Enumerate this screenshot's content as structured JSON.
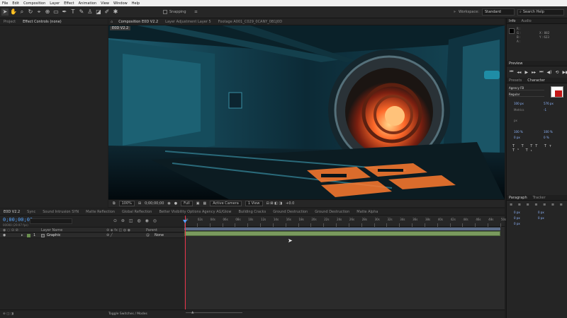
{
  "menu": [
    "File",
    "Edit",
    "Composition",
    "Layer",
    "Effect",
    "Animation",
    "View",
    "Window",
    "Help"
  ],
  "toolbar": {
    "snapping_label": "Snapping",
    "workspace_label": "Workspace:",
    "workspace_value": "Standard",
    "search_placeholder": "Search Help"
  },
  "project_tabs": [
    "Project",
    "Effect Controls (none)"
  ],
  "comp_tabs": [
    "Composition E0D V2.2",
    "Layer Adjustment Layer 5",
    "Footage A001_C029_0CANY_0B1J0D"
  ],
  "comp_crumb": "E0D V2.2",
  "viewer_bar": {
    "zoom": "100%",
    "time": "0;00;00;00",
    "resolution": "Full",
    "camera": "Active Camera",
    "views": "1 View",
    "offset": "+0.0"
  },
  "timeline_tabs": [
    "E0D V2.2",
    "Sync",
    "Sound Intrusion SYN",
    "Matte Reflection",
    "Global Reflection",
    "Better Visibility Options Agency AG/Glow",
    "Building Cracks",
    "Ground Destruction",
    "Ground Destruction",
    "Matte Alpha"
  ],
  "timeline": {
    "timecode": "0;00;00;00",
    "fps": "00000 (29.97 fps)",
    "col_source": "Layer Name",
    "col_parent": "Parent",
    "layer_num": "1",
    "layer_name": "Graphic",
    "layer_parent": "None",
    "ruler": [
      "0s",
      "02s",
      "04s",
      "06s",
      "08s",
      "10s",
      "12s",
      "14s",
      "16s",
      "18s",
      "20s",
      "22s",
      "24s",
      "26s",
      "28s",
      "30s",
      "32s",
      "34s",
      "36s",
      "38s",
      "40s",
      "42s",
      "44s",
      "46s",
      "48s",
      "50s"
    ],
    "toggle_label": "Toggle Switches / Modes"
  },
  "info_panel": {
    "tabs": [
      "Info",
      "Audio"
    ],
    "r": "R :",
    "g": "G :",
    "b": "B :",
    "a": "A :",
    "x": "X : 882",
    "y": "Y : 623"
  },
  "preview_panel": {
    "title": "Preview"
  },
  "character_panel": {
    "tabs": [
      "Presets",
      "Character"
    ],
    "font": "Agency FB",
    "style": "Regular",
    "size": "100 px",
    "leading": "576 px",
    "tracking_label": "Metrics",
    "tracking": "-1",
    "unit": "px",
    "vscale": "100 %",
    "hscale": "100 %",
    "baseline": "0 px",
    "tsume": "0 %"
  },
  "paragraph_panel": {
    "tabs": [
      "Paragraph",
      "Tracker"
    ],
    "indent1": "0 px",
    "indent2": "0 px",
    "indent3": "0 px",
    "space1": "0 px",
    "space2": "0 px"
  },
  "colors": {
    "accent": "#2d8ceb",
    "timecode": "#58a6ff",
    "layer_label": "#6a8f4e",
    "playhead": "#e8344a",
    "work_area": "#5c6e8a"
  }
}
